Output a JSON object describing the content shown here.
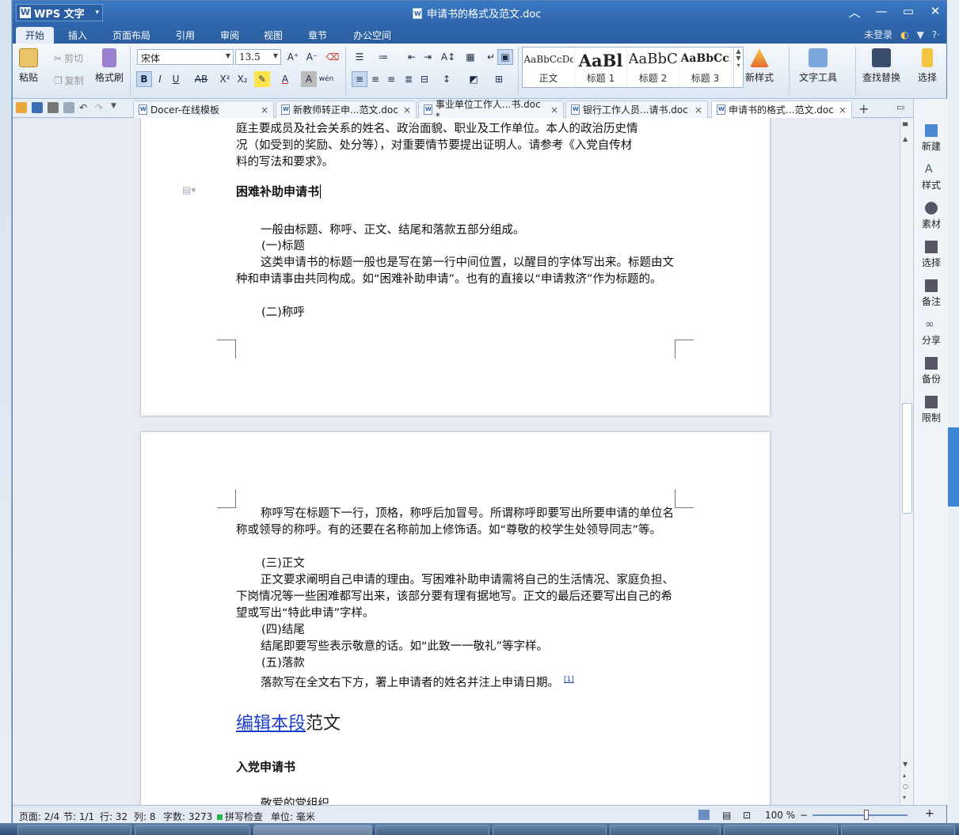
{
  "app": {
    "name": "WPS 文字",
    "doc_title": "申请书的格式及范文.doc"
  },
  "menu": {
    "tabs": [
      "开始",
      "插入",
      "页面布局",
      "引用",
      "审阅",
      "视图",
      "章节",
      "办公空间"
    ],
    "login": "未登录"
  },
  "ribbon": {
    "paste": "粘贴",
    "cut": "剪切",
    "copy": "复制",
    "format_painter": "格式刷",
    "font_name": "宋体",
    "font_size": "13.5",
    "styles": [
      {
        "preview": "AaBbCcDd",
        "name": "正文"
      },
      {
        "preview": "AaBl",
        "name": "标题 1"
      },
      {
        "preview": "AaBbC",
        "name": "标题 2"
      },
      {
        "preview": "AaBbCcI",
        "name": "标题 3"
      }
    ],
    "new_style": "新样式",
    "text_tools": "文字工具",
    "find_replace": "查找替换",
    "select": "选择"
  },
  "doc_tabs": [
    {
      "label": "Docer-在线模板",
      "active": false
    },
    {
      "label": "新教师转正申...范文.doc",
      "active": false
    },
    {
      "label": "事业单位工作人...书.doc *",
      "active": false
    },
    {
      "label": "银行工作人员...请书.doc",
      "active": false
    },
    {
      "label": "申请书的格式...范文.doc",
      "active": true
    }
  ],
  "page1": {
    "top_line1": "庭主要成员及社会关系的姓名、政治面貌、职业及工作单位。本人的政治历史情",
    "top_line2": "况（如受到的奖励、处分等），对重要情节要提出证明人。请参考《入党自传材",
    "top_line3": "料的写法和要求》。",
    "heading": "困难补助申请书",
    "p1": "一般由标题、称呼、正文、结尾和落款五部分组成。",
    "p2": "(一)标题",
    "p3": "这类申请书的标题一般也是写在第一行中间位置，以醒目的字体写出来。标题由文种和申请事由共同构成。如“困难补助申请”。也有的直接以“申请救济”作为标题的。",
    "p4": "(二)称呼"
  },
  "page2": {
    "p1": "称呼写在标题下一行，顶格，称呼后加冒号。所谓称呼即要写出所要申请的单位名称或领导的称呼。有的还要在名称前加上修饰语。如“尊敬的校学生处领导同志”等。",
    "p2": "(三)正文",
    "p3": "正文要求阐明自己申请的理由。写困难补助申请需将自己的生活情况、家庭负担、下岗情况等一些困难都写出来，该部分要有理有据地写。正文的最后还要写出自己的希望或写出“特此申请”字样。",
    "p4": "(四)结尾",
    "p5": "结尾即要写些表示敬意的话。如“此致一一敬礼”等字样。",
    "p6": "(五)落款",
    "p7": "落款写在全文右下方，署上申请者的姓名并注上申请日期。",
    "footnote": "[1]",
    "section_link": "编辑本段",
    "section_title": "范文",
    "sub_heading": "入党申请书",
    "cut_line": "敬爱的党组织"
  },
  "right_pane": [
    "新建",
    "样式",
    "素材",
    "选择",
    "备注",
    "分享",
    "备份",
    "限制"
  ],
  "status": {
    "page": "页面: 2/4",
    "section": "节: 1/1",
    "row": "行: 32",
    "col": "列: 8",
    "words": "字数: 3273",
    "spell": "拼写检查",
    "unit": "单位: 毫米",
    "zoom": "100 %"
  }
}
